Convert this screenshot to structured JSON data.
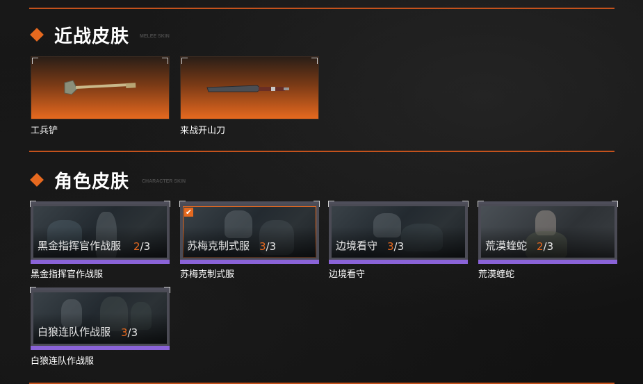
{
  "melee_section": {
    "title": "近战皮肤",
    "subtitle": "MELEE SKIN",
    "items": [
      {
        "name": "工兵铲",
        "icon": "shovel-icon"
      },
      {
        "name": "来战开山刀",
        "icon": "machete-icon"
      }
    ]
  },
  "character_section": {
    "title": "角色皮肤",
    "subtitle": "CHARACTER SKIN",
    "items": [
      {
        "card_name": "黑金指挥官作战服",
        "owned": "2",
        "total": "/3",
        "label": "黑金指挥官作战服",
        "selected": false
      },
      {
        "card_name": "苏梅克制式服",
        "owned": "3",
        "total": "/3",
        "label": "苏梅克制式服",
        "selected": true,
        "check": "✔"
      },
      {
        "card_name": "边境看守",
        "owned": "3",
        "total": "/3",
        "label": "边境看守",
        "selected": false
      },
      {
        "card_name": "荒漠蝰蛇",
        "owned": "2",
        "total": "/3",
        "label": "荒漠蝰蛇",
        "selected": false
      },
      {
        "card_name": "白狼连队作战服",
        "owned": "3",
        "total": "/3",
        "label": "白狼连队作战服",
        "selected": false
      }
    ]
  },
  "colors": {
    "accent": "#e6691f",
    "divider": "#c4521c",
    "card_purple": "#8a63d8",
    "background": "#141414"
  }
}
